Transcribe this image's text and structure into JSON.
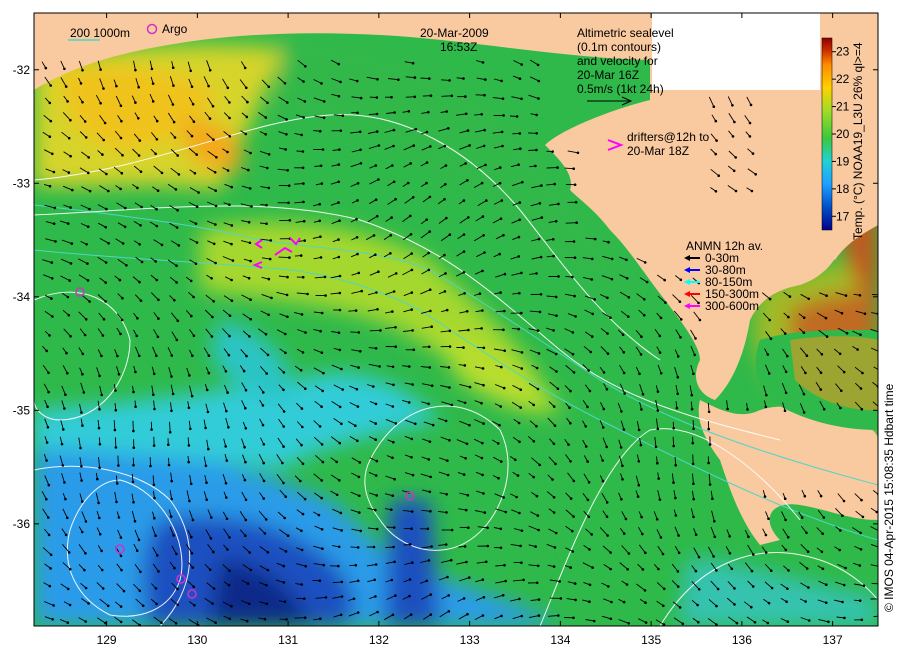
{
  "header": {
    "date": "20-Mar-2009",
    "time": "16:53Z"
  },
  "legend_top_left": {
    "isobath_label": "200  1000m",
    "argo_label": "Argo"
  },
  "altimetry_note": {
    "line1": "Altimetric sealevel",
    "line2": "(0.1m contours)",
    "line3": "and velocity for",
    "line4": "20-Mar 16Z",
    "line5": "0.5m/s (1kt 24h)"
  },
  "drifters_note": {
    "line1": "drifters@12h to",
    "line2": "20-Mar 18Z"
  },
  "anmn_legend": {
    "title": "ANMN 12h av.",
    "items": [
      {
        "label": "0-30m",
        "color": "#000000"
      },
      {
        "label": "30-80m",
        "color": "#0000ff"
      },
      {
        "label": "80-150m",
        "color": "#00ffff"
      },
      {
        "label": "150-300m",
        "color": "#ff0000"
      },
      {
        "label": "300-600m",
        "color": "#ff00ff"
      }
    ]
  },
  "colorbar": {
    "label": "Temp. (°C) NOAA19_L3U 26% ql>=4",
    "ticks": [
      "17",
      "18",
      "19",
      "20",
      "21",
      "22",
      "23"
    ],
    "min": 16.5,
    "max": 23.5,
    "colors": [
      "#00008b",
      "#0050c8",
      "#1ea0ff",
      "#22d2d2",
      "#3cc83c",
      "#a0dc28",
      "#ffd200",
      "#ff8c00",
      "#c82800",
      "#8b0000"
    ]
  },
  "axes": {
    "x_ticks": [
      "129",
      "130",
      "131",
      "132",
      "133",
      "134",
      "135",
      "136",
      "137"
    ],
    "y_ticks": [
      "-32",
      "-33",
      "-34",
      "-35",
      "-36"
    ],
    "lon_range": [
      128.2,
      137.5
    ],
    "lat_range": [
      -36.9,
      -31.5
    ]
  },
  "credit": "© IMOS 04-Apr-2015 15:08:35 Hdbart time",
  "colors": {
    "land": "#f9c9a0",
    "isobath": "#4fd6c8",
    "contour": "#ffffff",
    "argo": "#cc33cc",
    "drifter": "#ff00ff"
  }
}
